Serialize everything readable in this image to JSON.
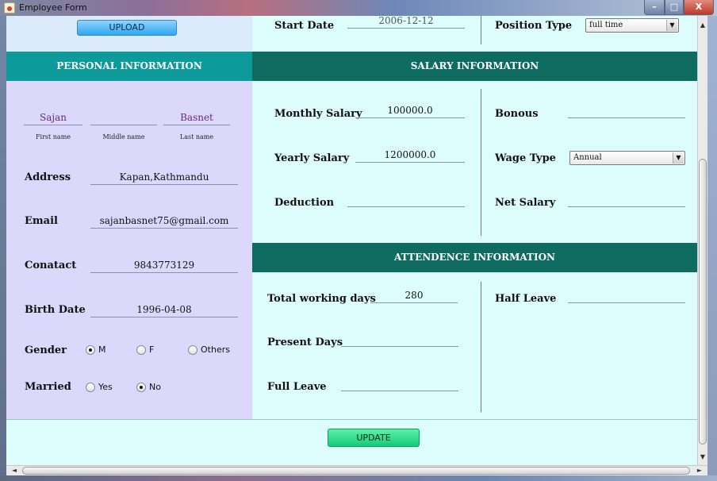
{
  "window": {
    "title": "Employee Form",
    "minimize": "–",
    "maximize": "□",
    "close": "X"
  },
  "top_row": {
    "upload_label": "UPLOAD",
    "start_date_label": "Start Date",
    "start_date_value": "2006-12-12",
    "position_type_label": "Position Type",
    "position_type_value": "full time"
  },
  "personal": {
    "header": "PERSONAL INFORMATION",
    "first_name": "Sajan",
    "middle_name": "",
    "last_name": "Basnet",
    "first_name_caption": "First name",
    "middle_name_caption": "Middle name",
    "last_name_caption": "Last name",
    "address_label": "Address",
    "address_value": "Kapan,Kathmandu",
    "email_label": "Email",
    "email_value": "sajanbasnet75@gmail.com",
    "contact_label": "Conatact",
    "contact_value": "9843773129",
    "birth_date_label": "Birth Date",
    "birth_date_value": "1996-04-08",
    "gender_label": "Gender",
    "gender_options": [
      "M",
      "F",
      "Others"
    ],
    "gender_selected": "M",
    "married_label": "Married",
    "married_options": [
      "Yes",
      "No"
    ],
    "married_selected": "No"
  },
  "salary": {
    "header": "SALARY INFORMATION",
    "monthly_label": "Monthly Salary",
    "monthly_value": "100000.0",
    "yearly_label": "Yearly Salary",
    "yearly_value": "1200000.0",
    "deduction_label": "Deduction",
    "deduction_value": "",
    "bonus_label": "Bonous",
    "bonus_value": "",
    "wage_type_label": "Wage Type",
    "wage_type_value": "Annual",
    "net_salary_label": "Net Salary",
    "net_salary_value": ""
  },
  "attendance": {
    "header": "ATTENDENCE INFORMATION",
    "total_days_label": "Total working days",
    "total_days_value": "280",
    "present_days_label": "Present Days",
    "present_days_value": "",
    "full_leave_label": "Full Leave",
    "full_leave_value": "",
    "half_leave_label": "Half Leave",
    "half_leave_value": ""
  },
  "actions": {
    "update_label": "UPDATE"
  },
  "scrollbar_glyphs": {
    "up": "▲",
    "down": "▼",
    "left": "◄",
    "right": "►",
    "dropdown": "▼"
  }
}
